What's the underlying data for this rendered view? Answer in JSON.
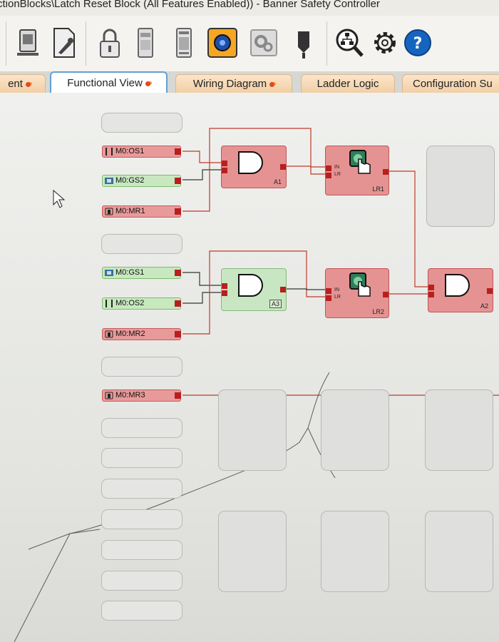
{
  "window": {
    "title": "ctionBlocks\\Latch Reset Block (All Features Enabled)) - Banner Safety Controller"
  },
  "toolbar": {
    "tools": [
      "device-icon",
      "edit-doc-icon",
      "lock-icon",
      "controller-icon",
      "module-icon",
      "network-icon",
      "settings-gears-icon",
      "probe-icon",
      "network-search-icon",
      "gear-icon",
      "help-icon"
    ]
  },
  "tabs": [
    {
      "label": "ent",
      "active": false
    },
    {
      "label": "Functional View",
      "active": true
    },
    {
      "label": "Wiring Diagram",
      "active": false
    },
    {
      "label": "Ladder Logic",
      "active": false
    },
    {
      "label": "Configuration Su",
      "active": false
    }
  ],
  "inputs": {
    "os1": "M0:OS1",
    "gs2": "M0:GS2",
    "mr1": "M0:MR1",
    "gs1": "M0:GS1",
    "os2": "M0:OS2",
    "mr2": "M0:MR2",
    "mr3": "M0:MR3"
  },
  "blocks": {
    "a1": "A1",
    "lr1": "LR1",
    "a3": "A3",
    "lr2": "LR2",
    "a2": "A2"
  },
  "pins": {
    "in": "IN",
    "lr": "LR"
  },
  "colors": {
    "active": "#e59392",
    "inactive": "#c9e6c2",
    "wire_red": "#c0392b",
    "wire_dark": "#2e3a2e"
  }
}
